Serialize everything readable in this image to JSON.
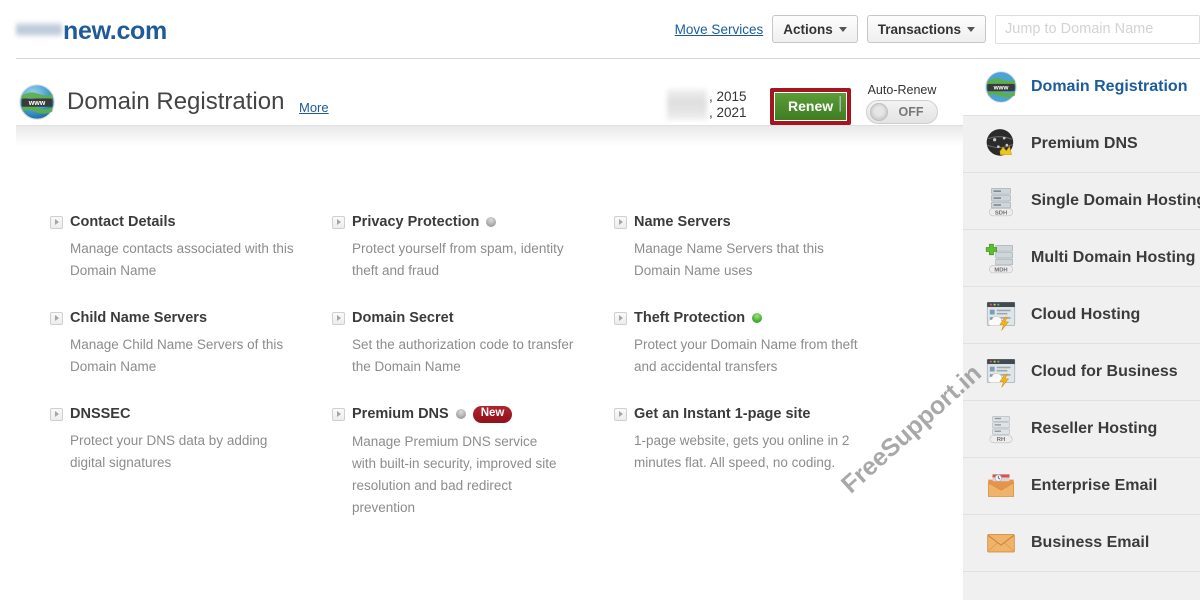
{
  "header": {
    "brand_suffix": "new.com",
    "brand_redacted": true,
    "move_services_label": "Move Services",
    "actions_label": "Actions",
    "transactions_label": "Transactions",
    "jump_placeholder": "Jump to Domain Name",
    "jump_value": ""
  },
  "service": {
    "icon": "globe-www-icon",
    "title": "Domain Registration",
    "more_label": "More",
    "registered_date": ", 2015",
    "expiry_date": ", 2021",
    "renew_label": "Renew",
    "renew_highlighted": true,
    "renew_highlight_color": "#a31621",
    "auto_renew_label": "Auto-Renew",
    "auto_renew_state": "OFF"
  },
  "features": [
    {
      "title": "Contact Details",
      "desc": "Manage contacts associated with this Domain Name",
      "status": null,
      "badge": null
    },
    {
      "title": "Privacy Protection",
      "desc": "Protect yourself from spam, identity theft and fraud",
      "status": "gray",
      "badge": null
    },
    {
      "title": "Name Servers",
      "desc": "Manage Name Servers that this Domain Name uses",
      "status": null,
      "badge": null
    },
    {
      "title": "Child Name Servers",
      "desc": "Manage Child Name Servers of this Domain Name",
      "status": null,
      "badge": null
    },
    {
      "title": "Domain Secret",
      "desc": "Set the authorization code to transfer the Domain Name",
      "status": null,
      "badge": null
    },
    {
      "title": "Theft Protection",
      "desc": "Protect your Domain Name from theft and accidental transfers",
      "status": "green",
      "badge": null
    },
    {
      "title": "DNSSEC",
      "desc": "Protect your DNS data by adding digital signatures",
      "status": null,
      "badge": null
    },
    {
      "title": "Premium DNS",
      "desc": "Manage Premium DNS service with built-in security, improved site resolution and bad redirect prevention",
      "status": "gray",
      "badge": "New"
    },
    {
      "title": "Get an Instant 1-page site",
      "desc": "1-page website, gets you online in 2 minutes flat. All speed, no coding.",
      "status": null,
      "badge": null
    }
  ],
  "sidebar": [
    {
      "label": "Domain Registration",
      "icon": "globe-www-icon",
      "active": true
    },
    {
      "label": "Premium DNS",
      "icon": "dark-globe-crown-icon",
      "active": false
    },
    {
      "label": "Single Domain Hosting",
      "icon": "sdh-server-icon",
      "active": false
    },
    {
      "label": "Multi Domain Hosting",
      "icon": "mdh-server-plus-icon",
      "active": false
    },
    {
      "label": "Cloud Hosting",
      "icon": "cloud-hosting-icon",
      "active": false
    },
    {
      "label": "Cloud for Business",
      "icon": "cloud-business-icon",
      "active": false
    },
    {
      "label": "Reseller Hosting",
      "icon": "rh-server-icon",
      "active": false
    },
    {
      "label": "Enterprise Email",
      "icon": "enterprise-email-icon",
      "active": false
    },
    {
      "label": "Business Email",
      "icon": "business-email-icon",
      "active": false
    }
  ],
  "watermark": {
    "text": "FreeSupport.in"
  },
  "colors": {
    "brand_blue": "#1f5a99",
    "link_blue": "#1a5c9c",
    "renew_green": "#4a8a2a",
    "highlight_red": "#a31621",
    "badge_red": "#9e1520",
    "sidebar_bg": "#f0f0f0"
  }
}
